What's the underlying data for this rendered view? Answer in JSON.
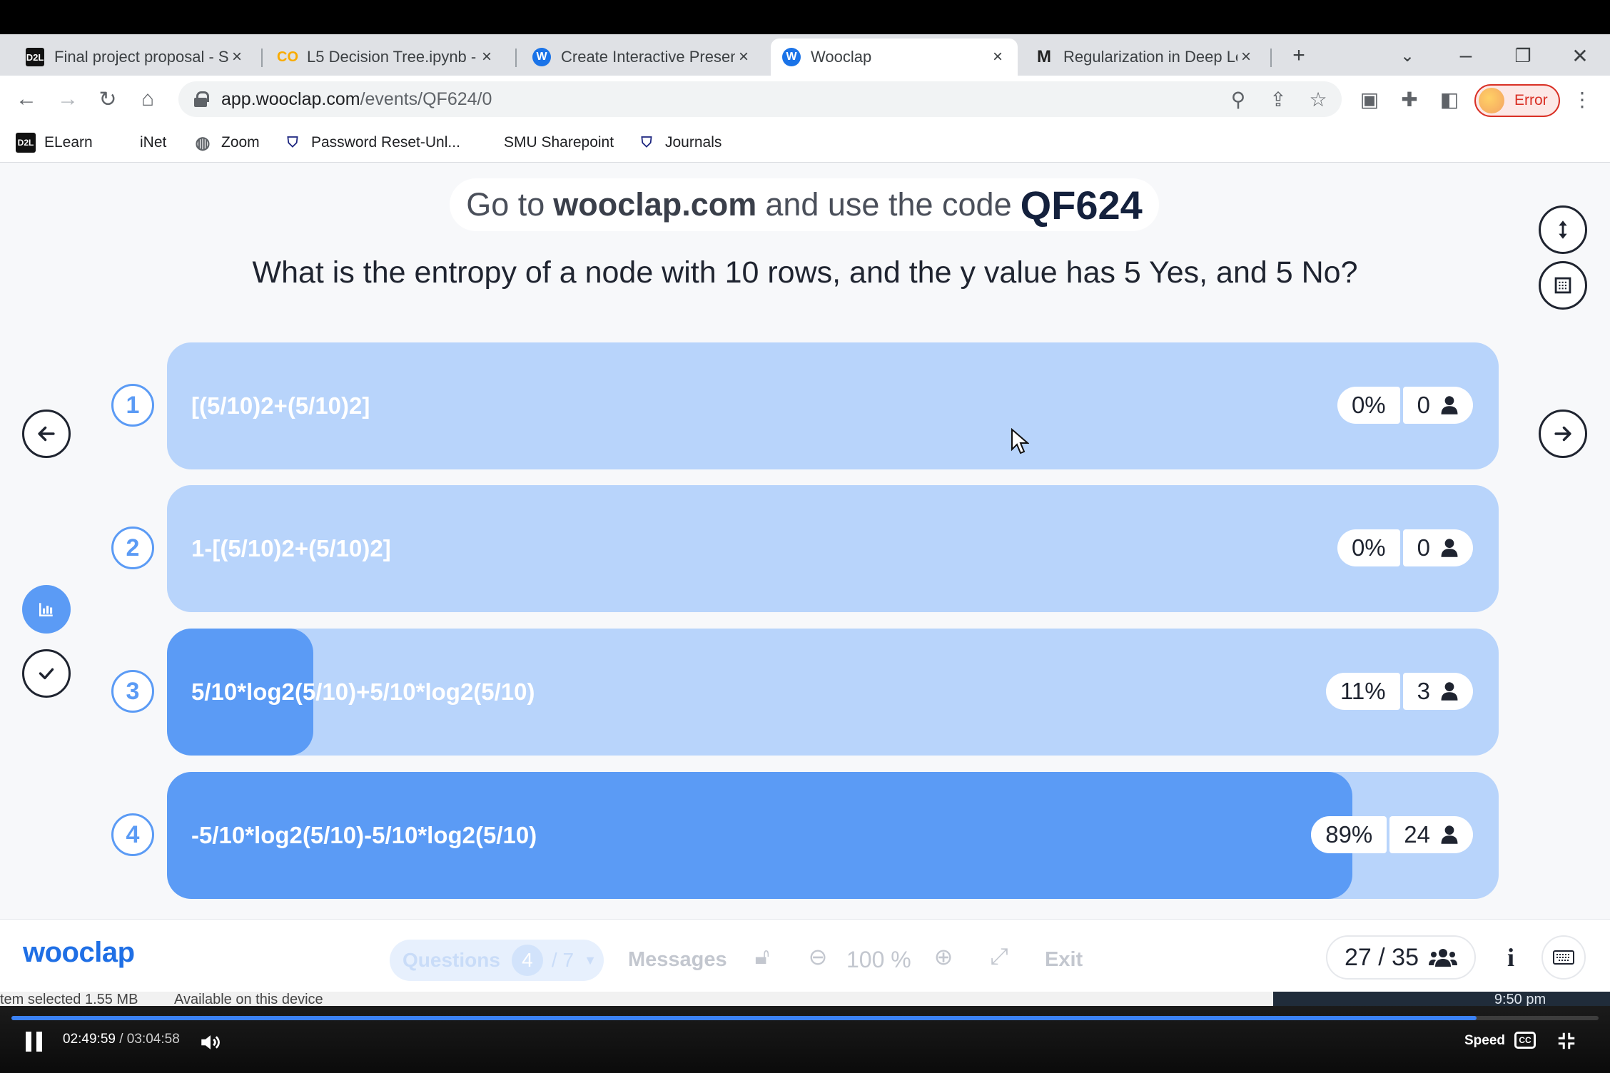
{
  "browser": {
    "tabs": [
      {
        "title": "Final project proposal - Su",
        "favicon": "d2l-icon",
        "favicon_text": "D2L"
      },
      {
        "title": "L5 Decision Tree.ipynb - C",
        "favicon": "colab-icon",
        "favicon_text": "CO"
      },
      {
        "title": "Create Interactive Present",
        "favicon": "wooclap-icon",
        "favicon_text": "W"
      },
      {
        "title": "Wooclap",
        "favicon": "wooclap-icon",
        "favicon_text": "W",
        "active": true
      },
      {
        "title": "Regularization in Deep Le",
        "favicon": "medium-icon",
        "favicon_text": "M"
      }
    ],
    "url_host": "app.wooclap.com",
    "url_path": "/events/QF624/0",
    "profile_status": "Error",
    "bookmarks": [
      {
        "label": "ELearn",
        "icon": "d2l-icon",
        "icon_text": "D2L"
      },
      {
        "label": "iNet",
        "icon": "microsoft-icon"
      },
      {
        "label": "Zoom",
        "icon": "globe-icon"
      },
      {
        "label": "Password Reset-Unl...",
        "icon": "smu-shield-icon"
      },
      {
        "label": "SMU Sharepoint",
        "icon": "microsoft-icon"
      },
      {
        "label": "Journals",
        "icon": "smu-shield-icon"
      }
    ]
  },
  "wooclap": {
    "join_prefix": "Go to",
    "join_site": "wooclap.com",
    "join_middle": "and use the code",
    "event_code": "QF624",
    "question": "What is the entropy of a node with 10 rows, and the y value has 5 Yes, and 5 No?",
    "answers": [
      {
        "number": "1",
        "text": "[(5/10)2+(5/10)2]",
        "percent": "0%",
        "votes": "0",
        "share": 0
      },
      {
        "number": "2",
        "text": "1-[(5/10)2+(5/10)2]",
        "percent": "0%",
        "votes": "0",
        "share": 0
      },
      {
        "number": "3",
        "text": "5/10*log2(5/10)+5/10*log2(5/10)",
        "percent": "11%",
        "votes": "3",
        "share": 0.11
      },
      {
        "number": "4",
        "text": "-5/10*log2(5/10)-5/10*log2(5/10)",
        "percent": "89%",
        "votes": "24",
        "share": 0.89
      }
    ],
    "bottom_bar": {
      "logo": "wooclap",
      "questions_label": "Questions",
      "question_current": "4",
      "question_total": "/ 7",
      "messages_label": "Messages",
      "zoom_level": "100 %",
      "exit_label": "Exit",
      "participants": "27 / 35",
      "info_label": "i"
    }
  },
  "player": {
    "file_status": "tem selected  1.55 MB",
    "availability": "Available on this device",
    "clock": "9:50 pm",
    "current_time": "02:49:59",
    "total_time": "/ 03:04:58",
    "speed_label": "Speed",
    "cc_label": "CC",
    "progress": 0.923
  },
  "colors": {
    "accent": "#5b9bf5",
    "bar_background": "#b8d4fb",
    "brand": "#1f6fe5",
    "error": "#d93025"
  }
}
